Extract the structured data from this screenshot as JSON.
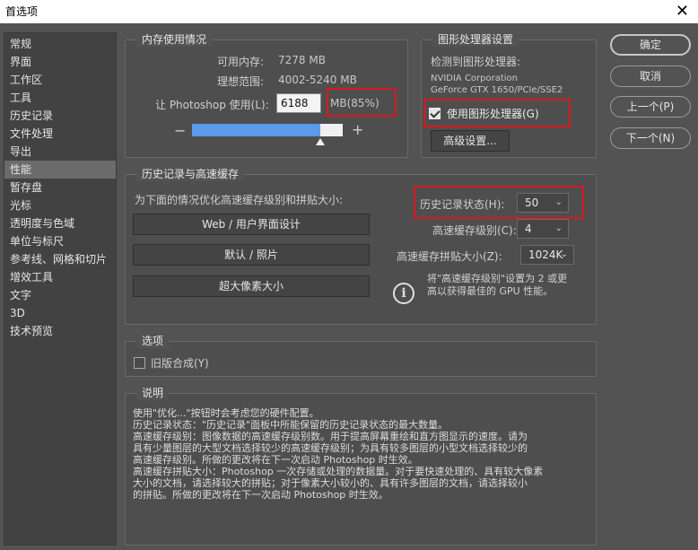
{
  "window": {
    "title": "首选项",
    "close_label": "✕"
  },
  "sidebar": {
    "items": [
      {
        "label": "常规"
      },
      {
        "label": "界面"
      },
      {
        "label": "工作区"
      },
      {
        "label": "工具"
      },
      {
        "label": "历史记录"
      },
      {
        "label": "文件处理"
      },
      {
        "label": "导出"
      },
      {
        "label": "性能"
      },
      {
        "label": "暂存盘"
      },
      {
        "label": "光标"
      },
      {
        "label": "透明度与色域"
      },
      {
        "label": "单位与标尺"
      },
      {
        "label": "参考线、网格和切片"
      },
      {
        "label": "增效工具"
      },
      {
        "label": "文字"
      },
      {
        "label": "3D"
      },
      {
        "label": "技术预览"
      }
    ],
    "active_index": 7
  },
  "memory": {
    "title": "内存使用情况",
    "available_label": "可用内存:",
    "available_value": "7278 MB",
    "ideal_label": "理想范围:",
    "ideal_value": "4002-5240 MB",
    "let_label": "让 Photoshop 使用(L):",
    "use_value": "6188",
    "mb_percent": "MB(85%)",
    "minus": "−",
    "plus": "+",
    "slider_fraction": 0.85
  },
  "gpu": {
    "title": "图形处理器设置",
    "detected_label": "检测到图形处理器:",
    "vendor": "NVIDIA Corporation",
    "model": "GeForce GTX 1650/PCIe/SSE2",
    "use_gpu_label": "使用图形处理器(G)",
    "use_gpu_checked": true,
    "advanced_button": "高级设置..."
  },
  "history_cache": {
    "title": "历史记录与高速缓存",
    "optimize_label": "为下面的情况优化高速缓存级别和拼贴大小:",
    "btn_web": "Web / 用户界面设计",
    "btn_default": "默认 / 照片",
    "btn_huge": "超大像素大小",
    "history_states_label": "历史记录状态(H):",
    "history_states_value": "50",
    "cache_levels_label": "高速缓存级别(C):",
    "cache_levels_value": "4",
    "tile_size_label": "高速缓存拼贴大小(Z):",
    "tile_size_value": "1024K",
    "info_text_1": "将\"高速缓存级别\"设置为 2 或更",
    "info_text_2": "高以获得最佳的 GPU 性能。",
    "info_icon": "i"
  },
  "options": {
    "title": "选项",
    "legacy_label": "旧版合成(Y)",
    "legacy_checked": false
  },
  "description": {
    "title": "说明",
    "lines": [
      "使用\"优化...\"按钮时会考虑您的硬件配置。",
      "历史记录状态：\"历史记录\"面板中所能保留的历史记录状态的最大数量。",
      "高速缓存级别：图像数据的高速缓存级别数。用于提高屏幕重绘和直方图显示的速度。请为",
      "具有少量图层的大型文档选择较少的高速缓存级别；为具有较多图层的小型文档选择较少的",
      "高速缓存级别。所做的更改将在下一次启动 Photoshop 时生效。",
      "高速缓存拼贴大小：Photoshop 一次存储或处理的数据量。对于要快速处理的、具有较大像素",
      "大小的文档，请选择较大的拼贴；对于像素大小较小的、具有许多图层的文档，请选择较小",
      "的拼贴。所做的更改将在下一次启动 Photoshop 时生效。"
    ]
  },
  "actions": {
    "ok": "确定",
    "cancel": "取消",
    "prev": "上一个(P)",
    "next": "下一个(N)"
  },
  "colors": {
    "bg": "#535353",
    "slider_fill": "#5b9bea",
    "highlight_red": "#d9181f"
  }
}
